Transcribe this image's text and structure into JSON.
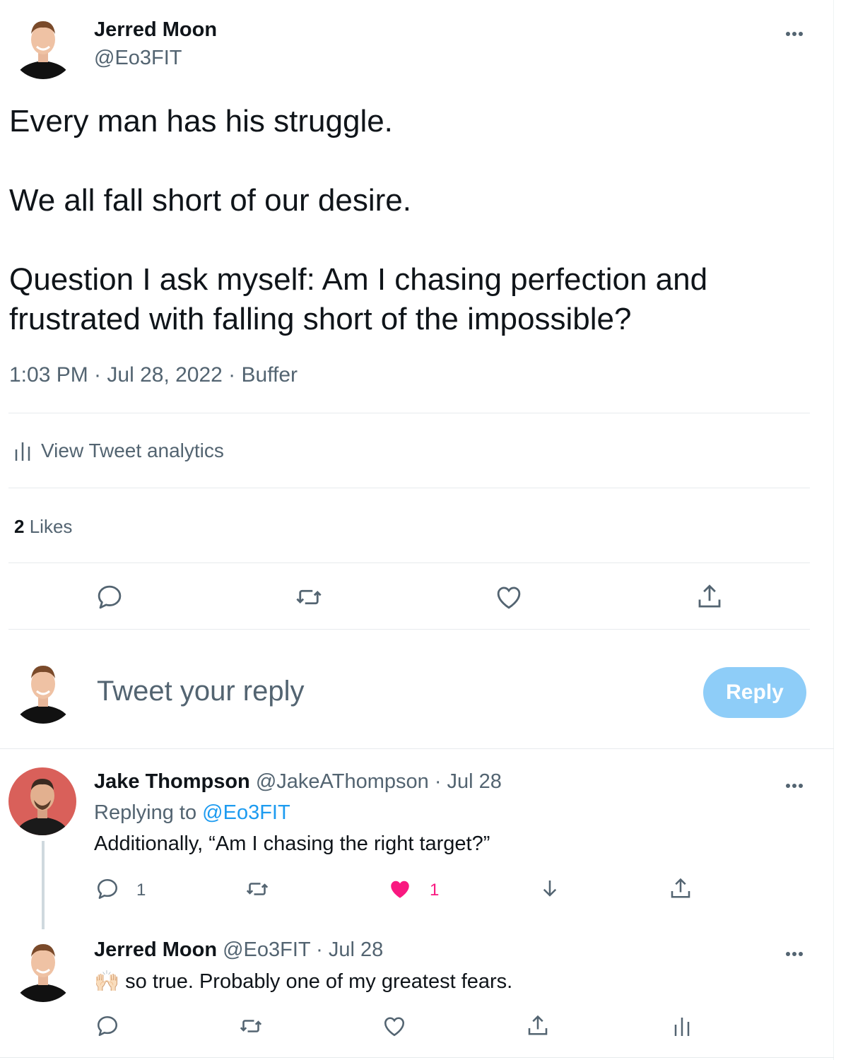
{
  "main_tweet": {
    "author_name": "Jerred Moon",
    "author_handle": "@Eo3FIT",
    "lines": [
      "Every man has his struggle.",
      "We all fall short of our desire.",
      "Question I ask myself: Am I chasing perfection and",
      "frustrated with falling short of the impossible?"
    ],
    "meta": "1:03 PM · Jul 28, 2022 · Buffer",
    "analytics_label": "View Tweet analytics",
    "likes_count": "2",
    "likes_label": "Likes"
  },
  "compose": {
    "placeholder": "Tweet your reply",
    "reply_button": "Reply"
  },
  "replies": [
    {
      "author_name": "Jake Thompson",
      "author_handle": "@JakeAThompson",
      "date": "· Jul 28",
      "replying_prefix": "Replying to",
      "replying_to": "@Eo3FIT",
      "text": "Additionally, “Am I chasing the right target?”",
      "reply_count": "1",
      "like_count": "1"
    },
    {
      "author_name": "Jerred Moon",
      "author_handle": "@Eo3FIT",
      "date": "· Jul 28",
      "emoji": "🙌🏻",
      "text": "so true. Probably one of my greatest fears."
    }
  ],
  "colors": {
    "text": "#0f1419",
    "secondary": "#536471",
    "accent": "#1d9bf0",
    "like": "#f91880",
    "reply_button_disabled": "#8ecdf8"
  },
  "icons": [
    "more-icon",
    "analytics-icon",
    "reply-icon",
    "retweet-icon",
    "like-icon",
    "share-icon",
    "download-icon"
  ]
}
